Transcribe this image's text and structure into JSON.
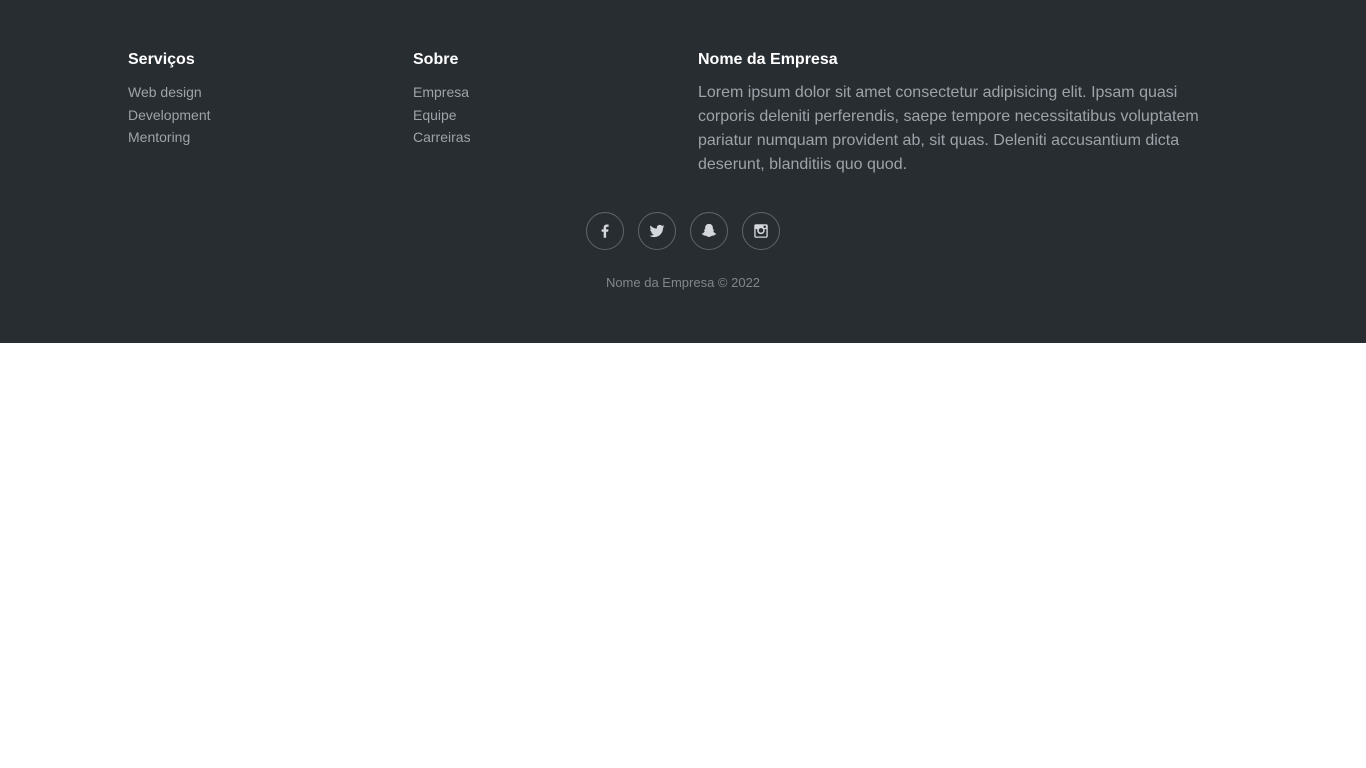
{
  "footer": {
    "columns": [
      {
        "title": "Serviços",
        "items": [
          "Web design",
          "Development",
          "Mentoring"
        ]
      },
      {
        "title": "Sobre",
        "items": [
          "Empresa",
          "Equipe",
          "Carreiras"
        ]
      }
    ],
    "about": {
      "title": "Nome da Empresa",
      "text": "Lorem ipsum dolor sit amet consectetur adipisicing elit. Ipsam quasi corporis deleniti perferendis, saepe tempore necessitatibus voluptatem pariatur numquam provident ab, sit quas. Deleniti accusantium dicta deserunt, blanditiis quo quod."
    },
    "social_icons": [
      "facebook-icon",
      "twitter-icon",
      "snapchat-icon",
      "instagram-icon"
    ],
    "copyright": "Nome da Empresa © 2022"
  },
  "colors": {
    "footer_background": "#282d32",
    "heading": "#ffffff",
    "muted_text": "#9da3a8",
    "copyright_text": "#80868b",
    "page_background": "#ffffff"
  }
}
